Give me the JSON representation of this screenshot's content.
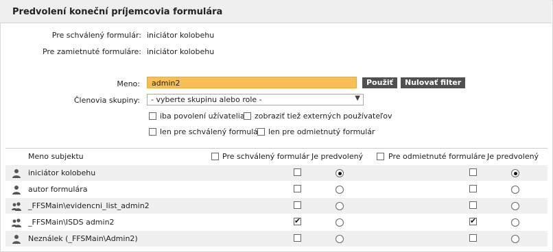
{
  "panel": {
    "title": "Predvolení koneční príjemcovia formulára"
  },
  "info": [
    {
      "label": "Pre schválený formulár:",
      "value": "iniciátor kolobehu"
    },
    {
      "label": "Pre zamietnuté formuláre:",
      "value": "iniciátor kolobehu"
    }
  ],
  "filter": {
    "name_label": "Meno:",
    "name_value": "admin2",
    "apply_label": "Použiť",
    "reset_label": "Nulovať filter",
    "group_label": "Členovia skupiny:",
    "group_value": "- vyberte skupinu alebo role -",
    "options": [
      {
        "label": "iba povolení užívatelia",
        "checked": false
      },
      {
        "label": "zobraziť tiež externých používateľov",
        "checked": false
      },
      {
        "label": "len pre schválený formulár",
        "checked": false
      },
      {
        "label": "len pre odmietnutý formulár",
        "checked": false
      }
    ]
  },
  "table": {
    "col_name": "Meno subjektu",
    "col_approved": "Pre schválený formulár",
    "col_default1": "Je predvolený",
    "col_rejected": "Pre odmietnuté formuláre",
    "col_default2": "Je predvolený",
    "rows": [
      {
        "name": "iniciátor kolobehu",
        "icon": "user-icon",
        "approved": false,
        "default1": true,
        "rejected": false,
        "default2": true
      },
      {
        "name": "autor formulára",
        "icon": "user-icon",
        "approved": false,
        "default1": false,
        "rejected": false,
        "default2": false
      },
      {
        "name": "_FFSMain\\evidencni_list_admin2",
        "icon": "group-icon",
        "approved": false,
        "default1": false,
        "rejected": false,
        "default2": false
      },
      {
        "name": "_FFSMain\\ISDS admin2",
        "icon": "group-icon",
        "approved": true,
        "default1": false,
        "rejected": true,
        "default2": false
      },
      {
        "name": "Neználek (_FFSMain\\Admin2)",
        "icon": "user-icon",
        "approved": false,
        "default1": false,
        "rejected": false,
        "default2": false
      }
    ]
  }
}
